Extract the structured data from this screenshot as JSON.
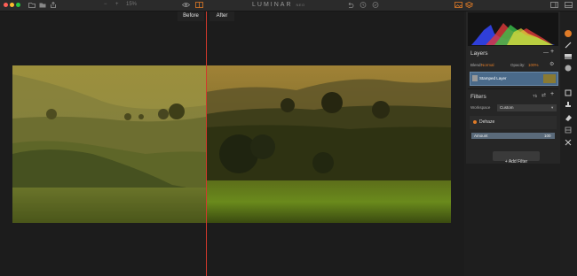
{
  "colors": {
    "accent": "#e07b27",
    "split": "#d2392c",
    "selected": "#4a6a8a"
  },
  "toolbar": {
    "zoom_minus": "−",
    "zoom_plus": "+",
    "zoom_value": "15%",
    "brand": "LUMINAR",
    "brand_sub": "NEO"
  },
  "compare": {
    "before_label": "Before",
    "after_label": "After"
  },
  "layers": {
    "title": "Layers",
    "blend_label": "Blend:",
    "blend_value": "Normal",
    "opacity_label": "Opacity:",
    "opacity_value": "100%",
    "layer_name": "Stamped Layer"
  },
  "filters": {
    "title": "Filters",
    "workspace_label": "Workspace",
    "workspace_value": "Custom",
    "filter_name": "Dehaze",
    "slider_label": "Amount",
    "slider_value": "100",
    "add_filter_label": "+ Add Filter"
  },
  "icons": [
    "search-icon",
    "folder-icon",
    "share-icon",
    "eye-icon",
    "compare-icon",
    "undo-icon",
    "history-icon",
    "layers-icon",
    "settings-icon",
    "brush-icon",
    "gradient-icon",
    "radial-icon",
    "crop-icon",
    "stamp-icon",
    "erase-icon",
    "transform-icon",
    "split-icon"
  ]
}
